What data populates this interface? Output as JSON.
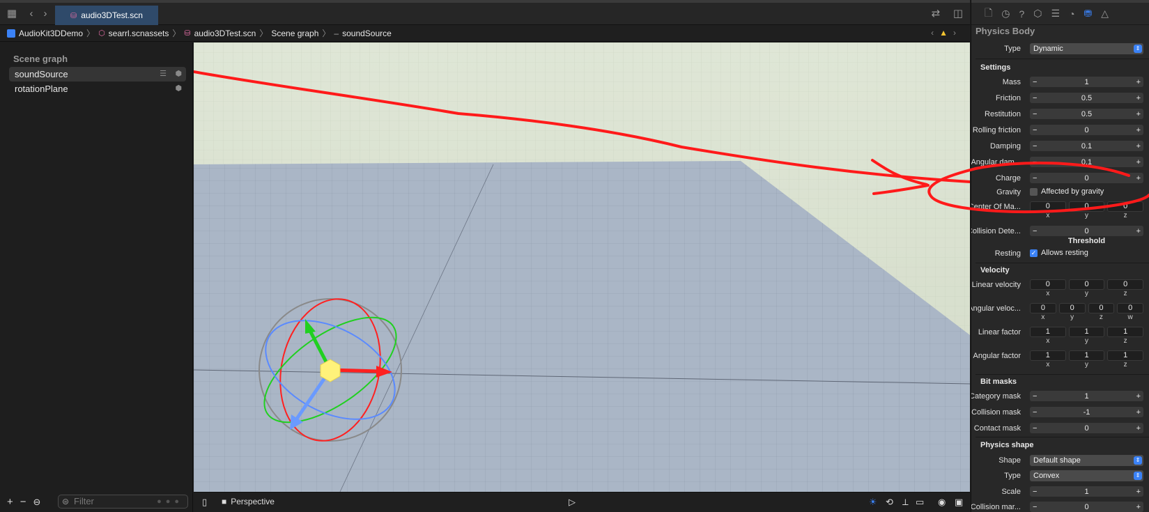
{
  "tab": {
    "filename": "audio3DTest.scn"
  },
  "breadcrumb": [
    {
      "label": "AudioKit3DDemo",
      "icon": "project-icon"
    },
    {
      "label": "searrl.scnassets",
      "icon": "scnassets-icon"
    },
    {
      "label": "audio3DTest.scn",
      "icon": "scn-file-icon"
    },
    {
      "label": "Scene graph",
      "icon": ""
    },
    {
      "label": "soundSource",
      "icon": "node-icon"
    }
  ],
  "scene_graph": {
    "title": "Scene graph",
    "nodes": [
      {
        "name": "soundSource",
        "selected": true
      },
      {
        "name": "rotationPlane",
        "selected": false
      }
    ],
    "filter_placeholder": "Filter"
  },
  "viewport": {
    "camera_label": "Perspective"
  },
  "inspector": {
    "title": "Physics Body",
    "type_label": "Type",
    "type_value": "Dynamic",
    "settings_title": "Settings",
    "mass": {
      "label": "Mass",
      "value": "1"
    },
    "friction": {
      "label": "Friction",
      "value": "0.5"
    },
    "restitution": {
      "label": "Restitution",
      "value": "0.5"
    },
    "rolling_friction": {
      "label": "Rolling friction",
      "value": "0"
    },
    "damping": {
      "label": "Damping",
      "value": "0.1"
    },
    "angular_damping": {
      "label": "Angular dam...",
      "value": "0.1"
    },
    "charge": {
      "label": "Charge",
      "value": "0"
    },
    "gravity": {
      "label": "Gravity",
      "check_label": "Affected by gravity",
      "checked": false
    },
    "center_of_mass": {
      "label": "Center Of Ma...",
      "x": "0",
      "y": "0",
      "z": "0"
    },
    "collision_detection": {
      "label": "Collision Dete...",
      "value": "0",
      "sub": "Threshold"
    },
    "resting": {
      "label": "Resting",
      "check_label": "Allows resting",
      "checked": true
    },
    "velocity_title": "Velocity",
    "linear_velocity": {
      "label": "Linear velocity",
      "x": "0",
      "y": "0",
      "z": "0"
    },
    "angular_velocity": {
      "label": "Angular veloc...",
      "x": "0",
      "y": "0",
      "z": "0",
      "w": "0"
    },
    "linear_factor": {
      "label": "Linear factor",
      "x": "1",
      "y": "1",
      "z": "1"
    },
    "angular_factor": {
      "label": "Angular factor",
      "x": "1",
      "y": "1",
      "z": "1"
    },
    "bitmasks_title": "Bit masks",
    "category_mask": {
      "label": "Category mask",
      "value": "1"
    },
    "collision_mask": {
      "label": "Collision mask",
      "value": "-1"
    },
    "contact_mask": {
      "label": "Contact mask",
      "value": "0"
    },
    "physics_shape_title": "Physics shape",
    "shape": {
      "label": "Shape",
      "value": "Default shape"
    },
    "shape_type": {
      "label": "Type",
      "value": "Convex"
    },
    "scale": {
      "label": "Scale",
      "value": "1"
    },
    "collision_margin": {
      "label": "Collision mar...",
      "value": "0"
    },
    "axis_labels": {
      "x": "x",
      "y": "y",
      "z": "z",
      "w": "w"
    }
  },
  "colors": {
    "accent": "#3b82f6",
    "annotation": "#ff1a1a",
    "scn_file": "#e26da4"
  }
}
